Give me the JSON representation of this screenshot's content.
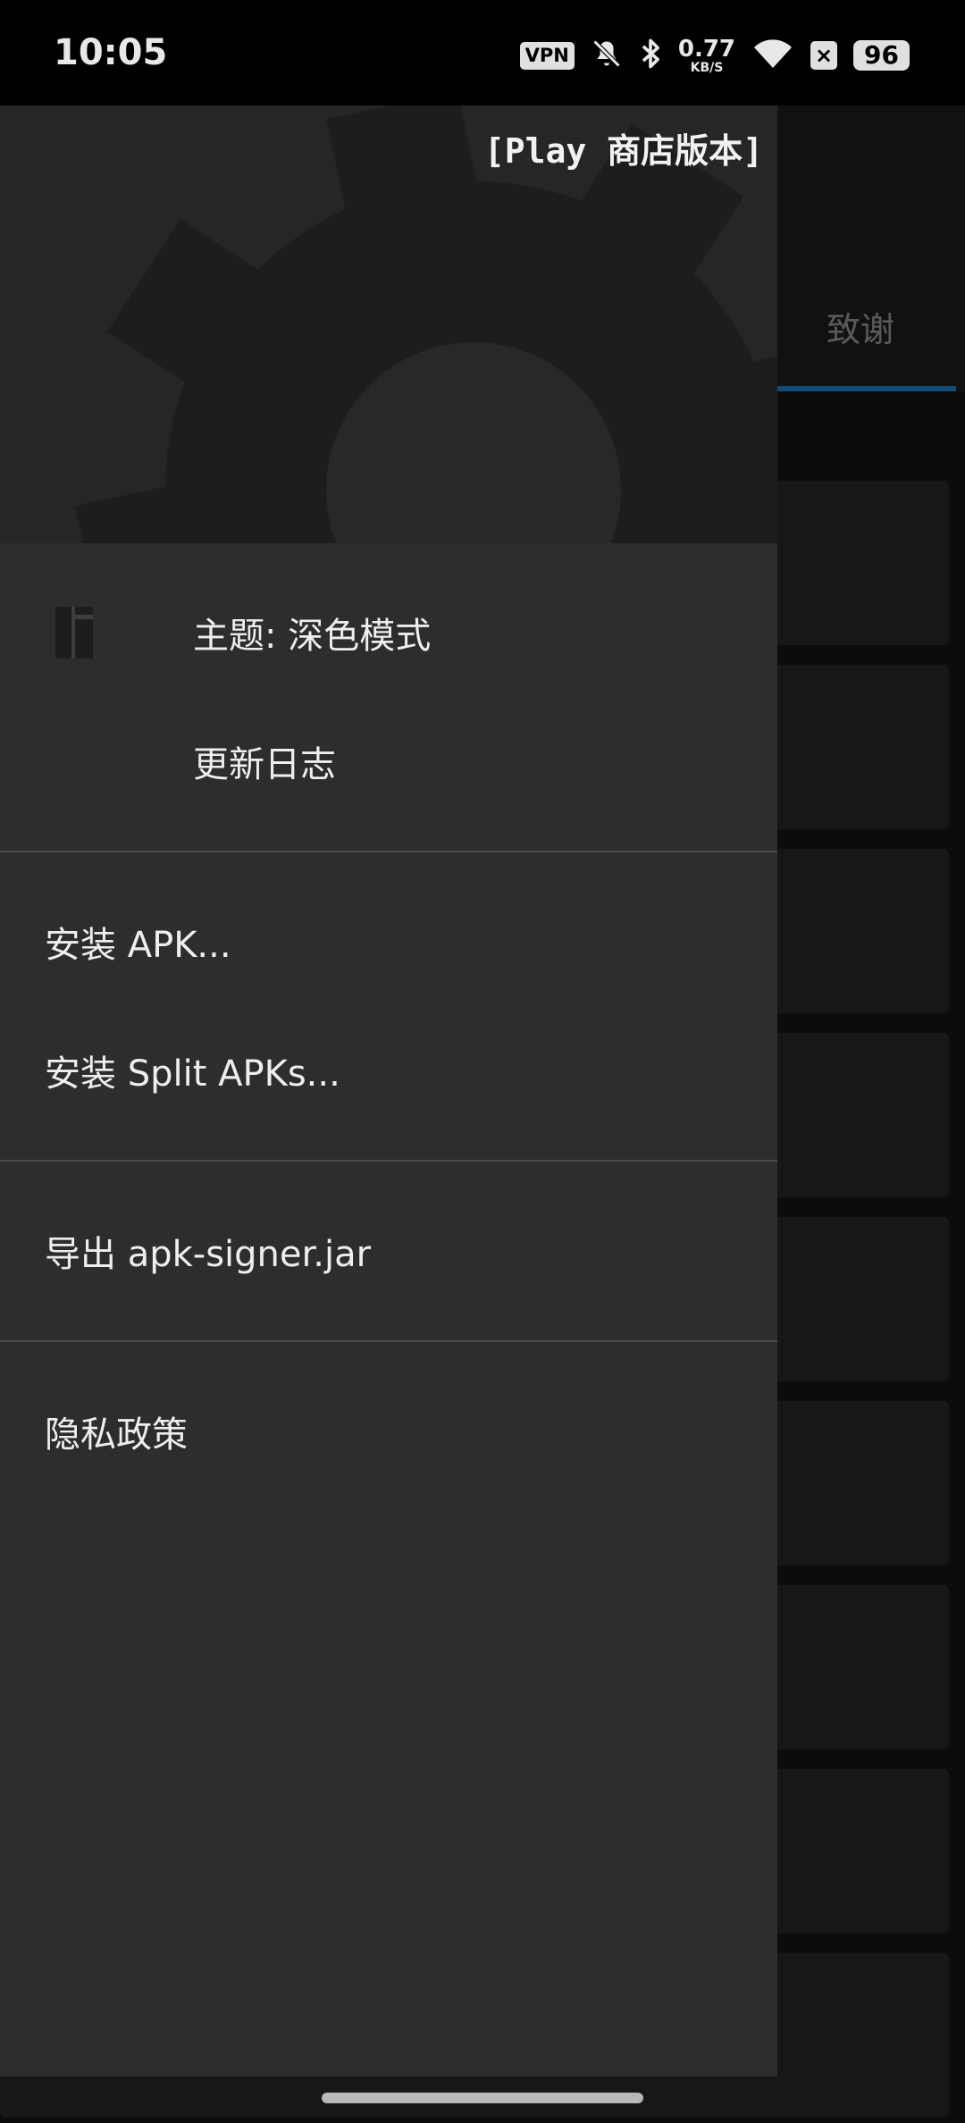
{
  "status_bar": {
    "time": "10:05",
    "vpn": "VPN",
    "net_speed_value": "0.77",
    "net_speed_unit": "KB/S",
    "sim_indicator": "×",
    "battery": "96",
    "icons": [
      "vpn-icon",
      "bell-off-icon",
      "bluetooth-icon",
      "wifi-icon",
      "sim-off-icon",
      "battery-icon"
    ]
  },
  "background_app": {
    "tab_label": "致谢",
    "accent_color": "#1e73be"
  },
  "drawer": {
    "header": {
      "version_label": "[Play 商店版本]",
      "art_icon": "gear-icon"
    },
    "items": [
      {
        "label": "主题: 深色模式",
        "icon": "theme-icon"
      },
      {
        "label": "更新日志"
      },
      {
        "label": "安装 APK..."
      },
      {
        "label": "安装 Split APKs..."
      },
      {
        "label": "导出 apk-signer.jar"
      },
      {
        "label": "隐私政策"
      }
    ]
  }
}
